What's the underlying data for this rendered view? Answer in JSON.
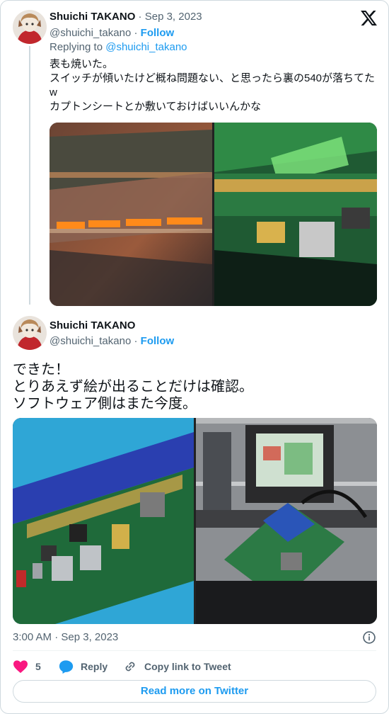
{
  "reply_tweet": {
    "author_name": "Shuichi TAKANO",
    "date_sep": " · ",
    "date": "Sep 3, 2023",
    "handle": "@shuichi_takano",
    "follow_sep": " · ",
    "follow_label": "Follow",
    "replying_prefix": "Replying to ",
    "replying_to": "@shuichi_takano",
    "text_lines": [
      "表も焼いた。",
      "スイッチが傾いたけど概ね問題ない、と思ったら裏の540が落ちてた",
      "w",
      "カプトンシートとか敷いておけばいいんかな"
    ]
  },
  "main_tweet": {
    "author_name": "Shuichi TAKANO",
    "handle": "@shuichi_takano",
    "follow_sep": " · ",
    "follow_label": "Follow",
    "text_lines": [
      "できた！",
      "とりあえず絵が出ることだけは確認。",
      "ソフトウェア側はまた今度。"
    ],
    "timestamp": "3:00 AM · Sep 3, 2023"
  },
  "actions": {
    "like_count": "5",
    "reply_label": "Reply",
    "copy_label": "Copy link to Tweet"
  },
  "read_more_label": "Read more on Twitter",
  "icons": [
    "x-logo-icon",
    "heart-icon",
    "reply-bubble-icon",
    "link-icon",
    "info-icon"
  ],
  "colors": {
    "accent": "#1d9bf0",
    "like": "#f91880",
    "secondary_text": "#536471",
    "border": "#cfd9de"
  }
}
